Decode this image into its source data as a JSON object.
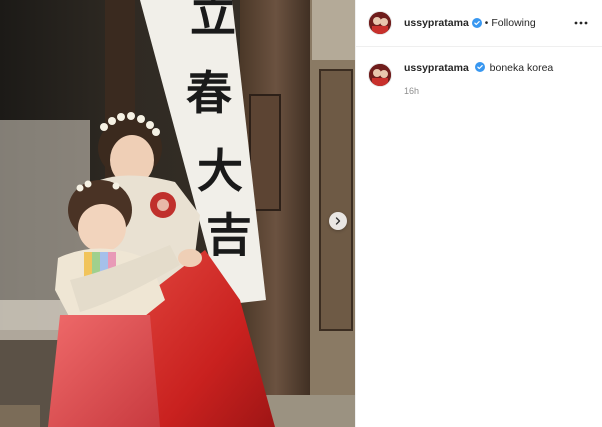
{
  "post": {
    "author": {
      "username": "ussypratama",
      "verified": true,
      "follow_state": "Following",
      "avatar_icon": "profile-photo-avatar"
    },
    "more_icon": "more-options-icon",
    "media": {
      "next_icon": "chevron-right-icon",
      "sign_text": [
        "立",
        "春",
        "大",
        "吉"
      ]
    },
    "caption": {
      "username": "ussypratama",
      "text": "boneka korea",
      "time": "16h"
    }
  },
  "colors": {
    "verified_blue": "#3897f0",
    "text": "#262626",
    "muted": "#8e8e8e",
    "divider": "#efefef",
    "hanbok_red": "#d6342f"
  }
}
